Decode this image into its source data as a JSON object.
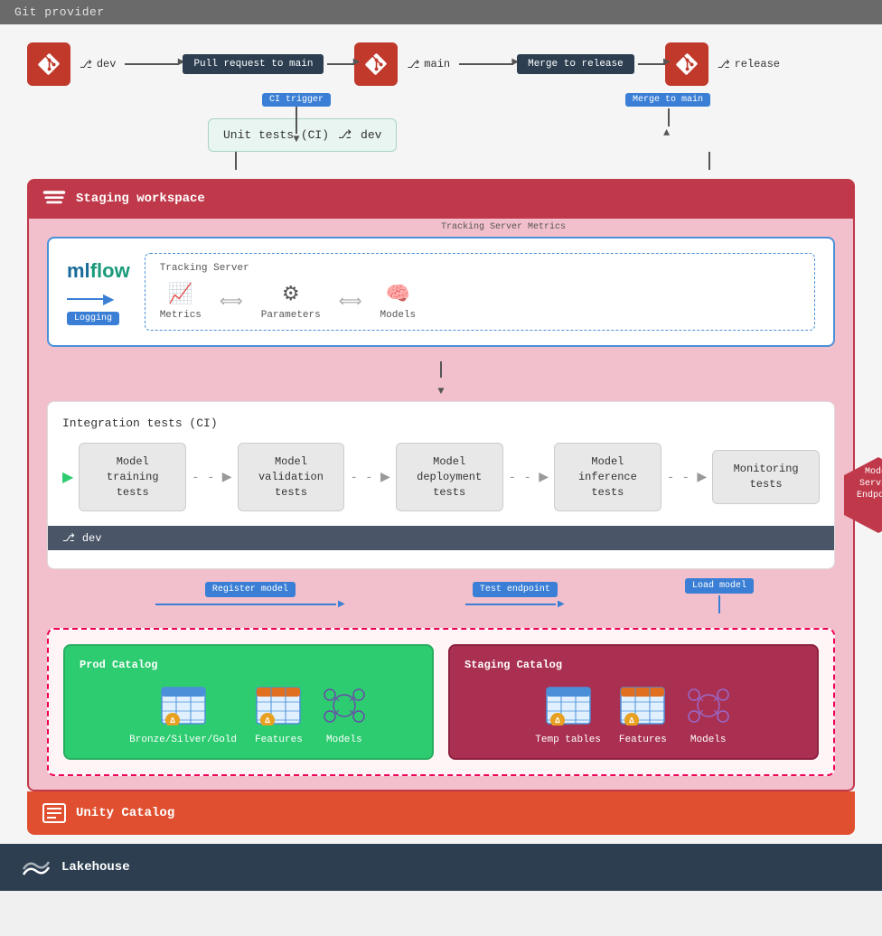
{
  "topBar": {
    "label": "Git provider"
  },
  "gitFlow": {
    "devBranch": "dev",
    "mainBranch": "main",
    "releaseBranch": "release",
    "pullRequestLabel": "Pull request to main",
    "mergeToReleaseLabel": "Merge to release",
    "mergeToMainLabel": "Merge to main",
    "ciTriggerLabel": "CI trigger"
  },
  "unitTests": {
    "label": "Unit tests (CI)",
    "branch": "dev"
  },
  "stagingWorkspace": {
    "label": "Staging workspace"
  },
  "mlflow": {
    "logo": "mlflow",
    "loggingBadge": "Logging",
    "trackingServer": {
      "title": "Tracking Server",
      "metrics": "Metrics",
      "parameters": "Parameters",
      "models": "Models"
    }
  },
  "integrationTests": {
    "title": "Integration tests (CI)",
    "steps": [
      {
        "label": "Model\ntraining\ntests"
      },
      {
        "label": "Model\nvalidation\ntests"
      },
      {
        "label": "Model\ndeployment\ntests"
      },
      {
        "label": "Model\ninference\ntests"
      },
      {
        "label": "Monitoring\ntests"
      }
    ],
    "devBranch": "dev"
  },
  "modelServingEndpoint": {
    "label": "Model\nServing\nEndpoint"
  },
  "flowLabels": {
    "registerModel": "Register model",
    "testEndpoint": "Test endpoint",
    "loadModel": "Load model"
  },
  "unityCatalog": {
    "label": "Unity Catalog",
    "prodCatalog": {
      "title": "Prod Catalog",
      "items": [
        {
          "label": "Bronze/Silver/Gold",
          "type": "table"
        },
        {
          "label": "Features",
          "type": "table"
        },
        {
          "label": "Models",
          "type": "model"
        }
      ]
    },
    "stagingCatalog": {
      "title": "Staging Catalog",
      "items": [
        {
          "label": "Temp tables",
          "type": "table"
        },
        {
          "label": "Features",
          "type": "table"
        },
        {
          "label": "Models",
          "type": "model"
        }
      ]
    }
  },
  "lakehouse": {
    "label": "Lakehouse"
  }
}
